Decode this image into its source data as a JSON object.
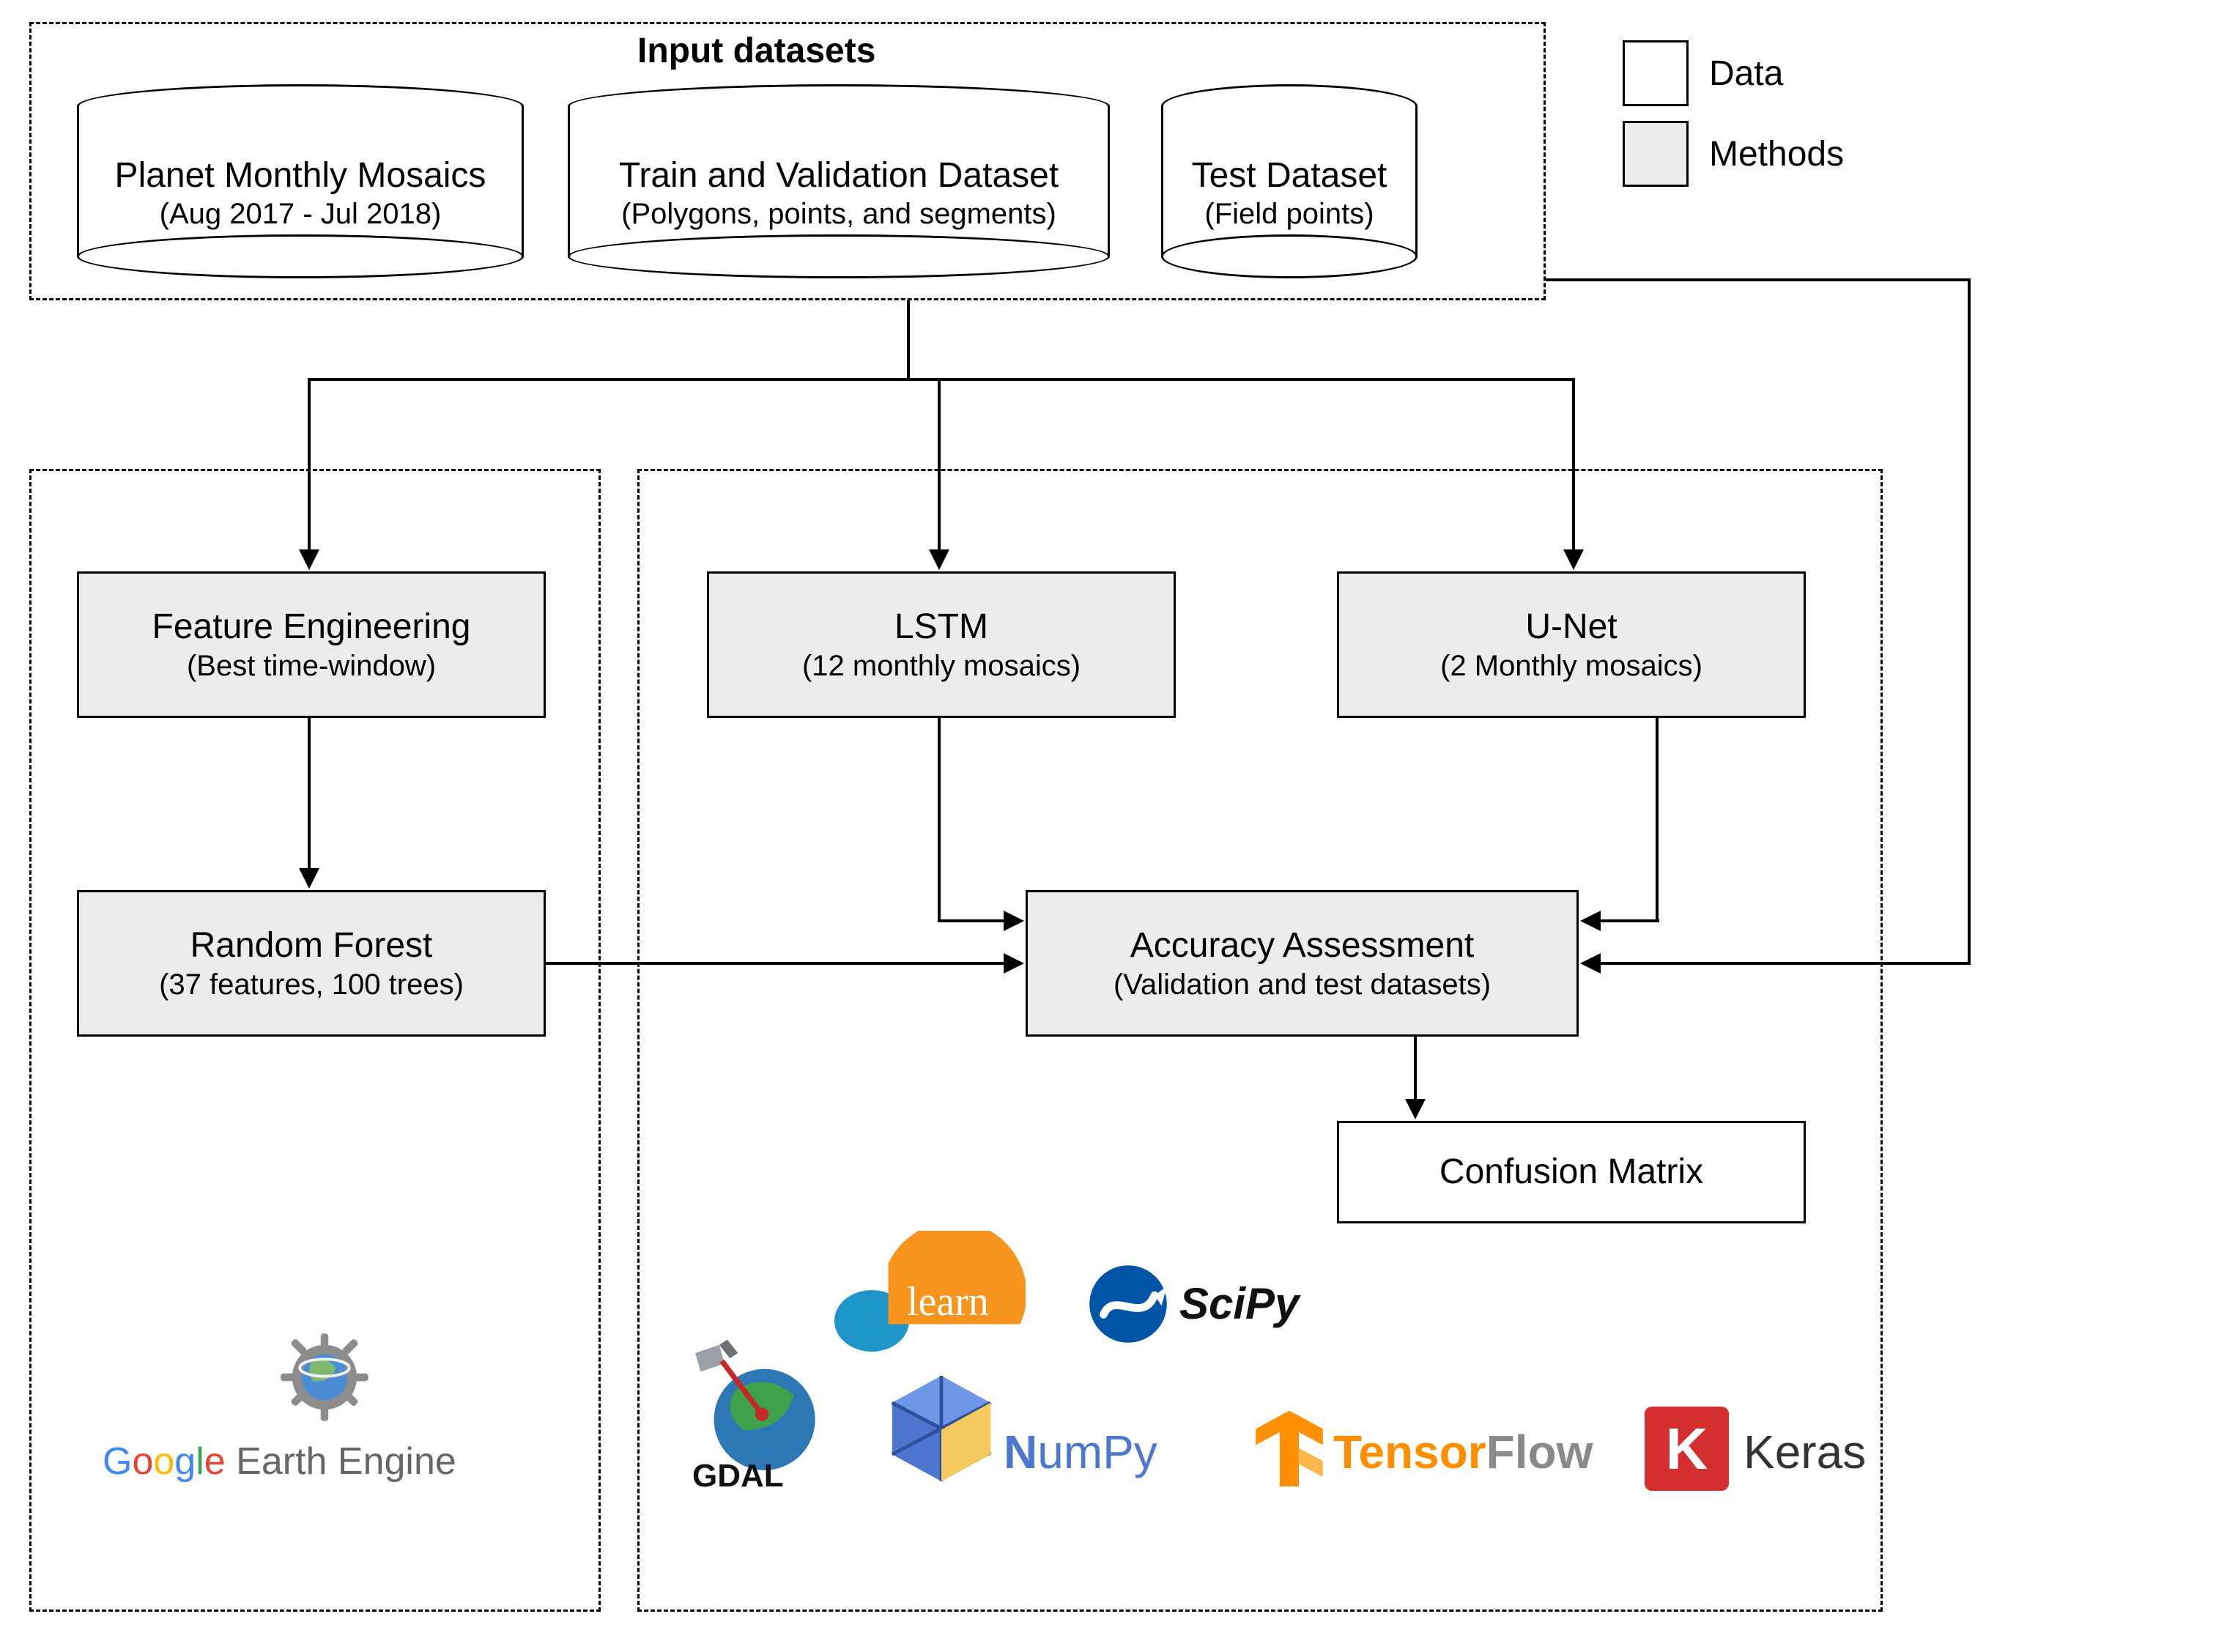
{
  "input_datasets": {
    "group_title": "Input datasets",
    "planet": {
      "title": "Planet Monthly Mosaics",
      "subtitle": "(Aug 2017 - Jul 2018)"
    },
    "train_val": {
      "title": "Train and Validation Dataset",
      "subtitle": "(Polygons, points, and segments)"
    },
    "test": {
      "title": "Test Dataset",
      "subtitle": "(Field points)"
    }
  },
  "methods": {
    "feature_eng": {
      "title": "Feature Engineering",
      "subtitle": "(Best time-window)"
    },
    "rf": {
      "title": "Random Forest",
      "subtitle": "(37 features, 100 trees)"
    },
    "lstm": {
      "title": "LSTM",
      "subtitle": "(12 monthly mosaics)"
    },
    "unet": {
      "title": "U-Net",
      "subtitle": "(2 Monthly mosaics)"
    },
    "accuracy": {
      "title": "Accuracy Assessment",
      "subtitle": "(Validation and test datasets)"
    }
  },
  "outputs": {
    "confusion": {
      "title": "Confusion Matrix"
    }
  },
  "legend": {
    "data": "Data",
    "methods": "Methods"
  },
  "logos": {
    "gee_google": "Google",
    "gee_rest": " Earth Engine",
    "gdal": "GDAL",
    "sklearn": "learn",
    "numpy_n": "N",
    "numpy_rest": "umPy",
    "scipy": "SciPy",
    "tensorflow": "TensorFlow",
    "keras_k": "K",
    "keras": "Keras"
  }
}
